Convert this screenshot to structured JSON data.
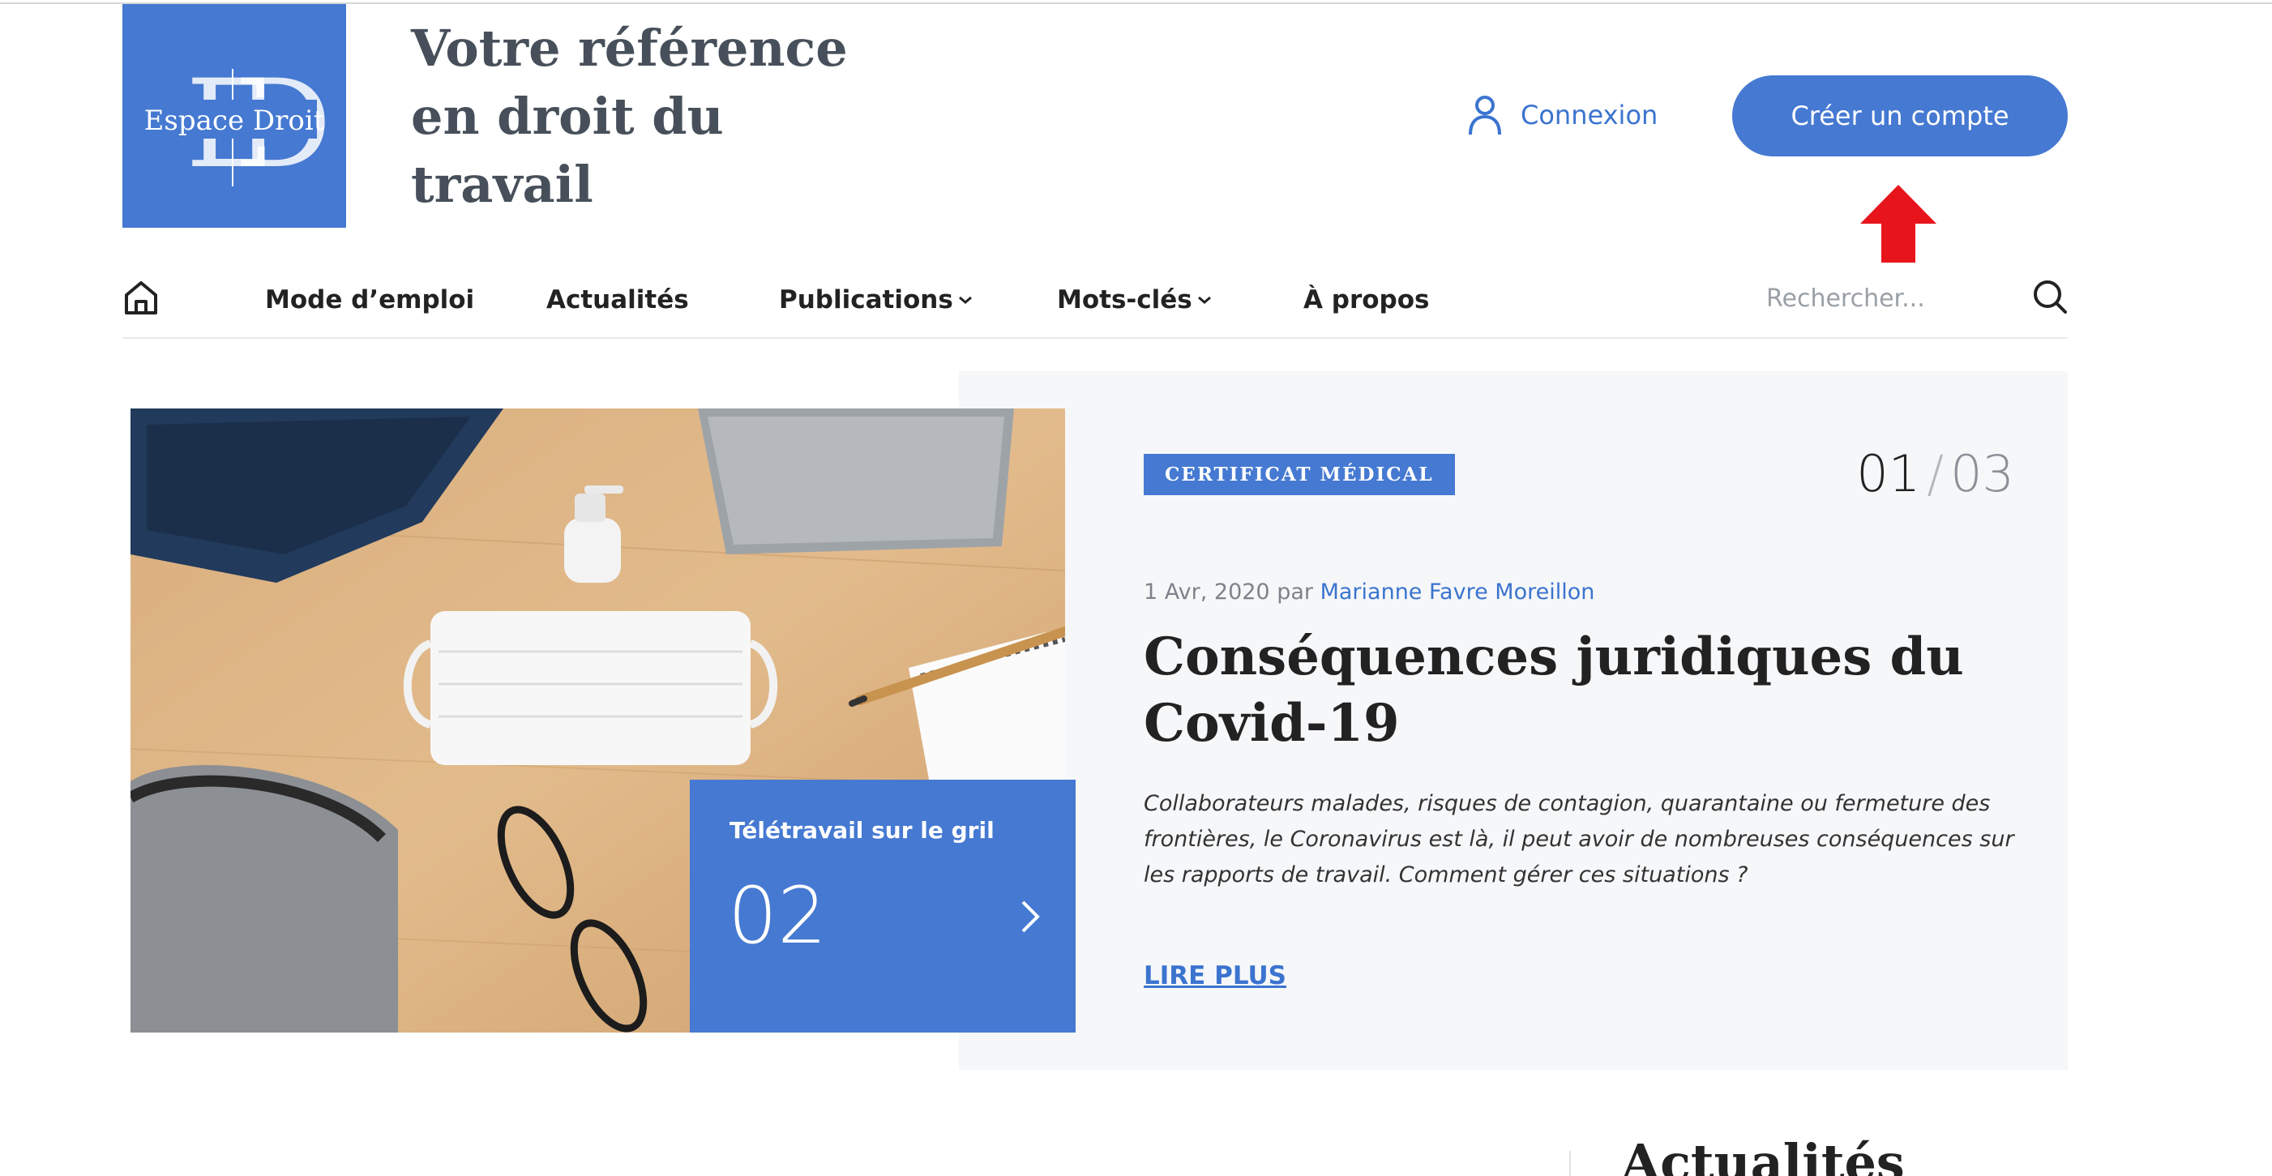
{
  "header": {
    "logo_text": "Espace Droit",
    "logo_letters": "ED",
    "tagline": "Votre référence en droit du travail",
    "login_label": "Connexion",
    "create_account_label": "Créer un compte"
  },
  "nav": {
    "items": [
      {
        "label": "Mode d’emploi",
        "has_dropdown": false
      },
      {
        "label": "Actualités",
        "has_dropdown": false
      },
      {
        "label": "Publications",
        "has_dropdown": true
      },
      {
        "label": "Mots-clés",
        "has_dropdown": true
      },
      {
        "label": "À propos",
        "has_dropdown": false
      }
    ],
    "search_placeholder": "Rechercher..."
  },
  "hero": {
    "category": "CERTIFICAT MÉDICAL",
    "counter_current": "01",
    "counter_separator": "/",
    "counter_total": "03",
    "date": "1 Avr, 2020",
    "by": "par",
    "author": "Marianne Favre Moreillon",
    "title": "Conséquences juridiques du Covid-19",
    "excerpt": "Collaborateurs malades, risques de contagion, quarantaine ou fermeture des frontières, le Coronavirus est là, il peut avoir de nombreuses conséquences sur les rapports de travail. Comment gérer ces situations ?",
    "read_more": "LIRE PLUS",
    "next_slide_title": "Télétravail sur le gril",
    "next_slide_number": "02"
  },
  "sections": {
    "right_title": "Actualités"
  },
  "colors": {
    "brand_blue": "#4579d2",
    "link_blue": "#3b74cf",
    "arrow_red": "#e8141c",
    "hero_bg": "#f6f7f9"
  },
  "icons": {
    "home": "home-icon",
    "user": "user-icon",
    "search": "search-icon",
    "chevron_down": "chevron-down-icon",
    "chevron_right": "chevron-right-icon",
    "arrow_up": "arrow-up-icon"
  }
}
